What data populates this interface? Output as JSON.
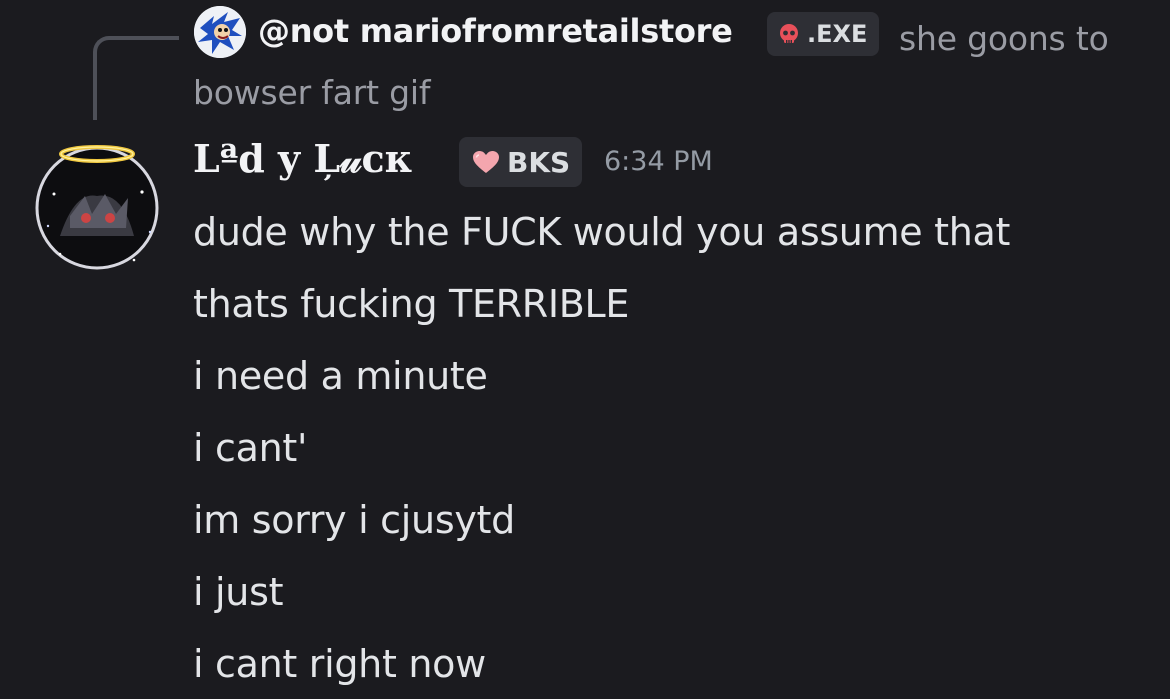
{
  "reply": {
    "author": "@not mariofromretailstore",
    "tag": ".EXE",
    "tag_icon": "skull-icon",
    "text": "she goons to bowser fart gif"
  },
  "message": {
    "author": "Lªd y Ļ𝓊ᴄᴋ",
    "tag": "BKS",
    "tag_icon": "heart-icon",
    "timestamp": "6:34 PM",
    "lines": [
      "dude why the FUCK would you assume that",
      "thats fucking TERRIBLE",
      "i need a minute",
      "i cant'",
      "im sorry i cjusytd",
      "i just",
      "i cant right now"
    ]
  },
  "colors": {
    "background": "#1b1b1f",
    "reply_text": "#9a9ca4",
    "tag_bg": "#2e2f35",
    "timestamp": "#949ba4",
    "skull": "#e8505a",
    "heart": "#f4a6ae"
  }
}
